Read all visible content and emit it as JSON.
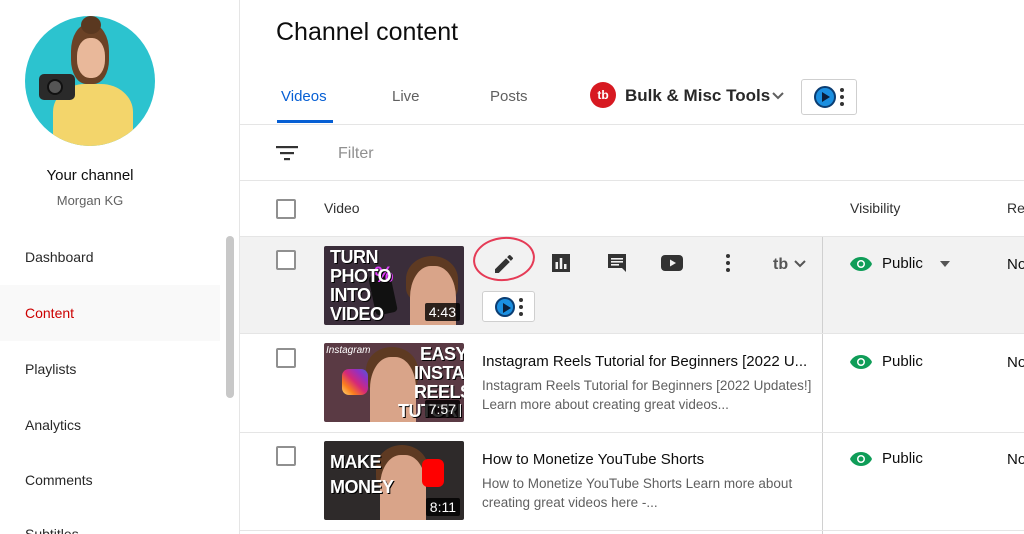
{
  "sidebar": {
    "channel_title": "Your channel",
    "channel_name": "Morgan KG",
    "items": [
      {
        "label": "Dashboard"
      },
      {
        "label": "Content"
      },
      {
        "label": "Playlists"
      },
      {
        "label": "Analytics"
      },
      {
        "label": "Comments"
      },
      {
        "label": "Subtitles"
      }
    ]
  },
  "page": {
    "title": "Channel content"
  },
  "tabs": [
    {
      "label": "Videos"
    },
    {
      "label": "Live"
    },
    {
      "label": "Posts"
    }
  ],
  "extension": {
    "logo_text": "tb",
    "bulk_label": "Bulk & Misc Tools"
  },
  "filter": {
    "label": "Filter"
  },
  "table": {
    "headers": {
      "video": "Video",
      "visibility": "Visibility",
      "restrictions": "Re"
    },
    "rows": [
      {
        "thumb_text": [
          "TURN",
          "PHOTO",
          "INTO",
          "VIDEO"
        ],
        "duration": "4:43",
        "visibility": "Public",
        "restrictions": "No"
      },
      {
        "thumb_label": "Instagram",
        "thumb_text": [
          "EASY",
          "INSTA",
          "REELS",
          "TUTORI"
        ],
        "duration": "7:57",
        "title": "Instagram Reels Tutorial for Beginners [2022 U...",
        "description": "Instagram Reels Tutorial for Beginners [2022 Updates!] Learn more about creating great videos...",
        "visibility": "Public",
        "restrictions": "No"
      },
      {
        "thumb_text": [
          "MAKE",
          "MONEY"
        ],
        "duration": "8:11",
        "title": "How to Monetize YouTube Shorts",
        "description": "How to Monetize YouTube Shorts Learn more about creating great videos here -...",
        "visibility": "Public",
        "restrictions": "No"
      }
    ]
  },
  "colors": {
    "accent_blue": "#065fd4",
    "active_red": "#cc0000",
    "public_green": "#0f9d58",
    "tubebuddy_red": "#d71921",
    "annotation_circle": "#e53b56"
  }
}
